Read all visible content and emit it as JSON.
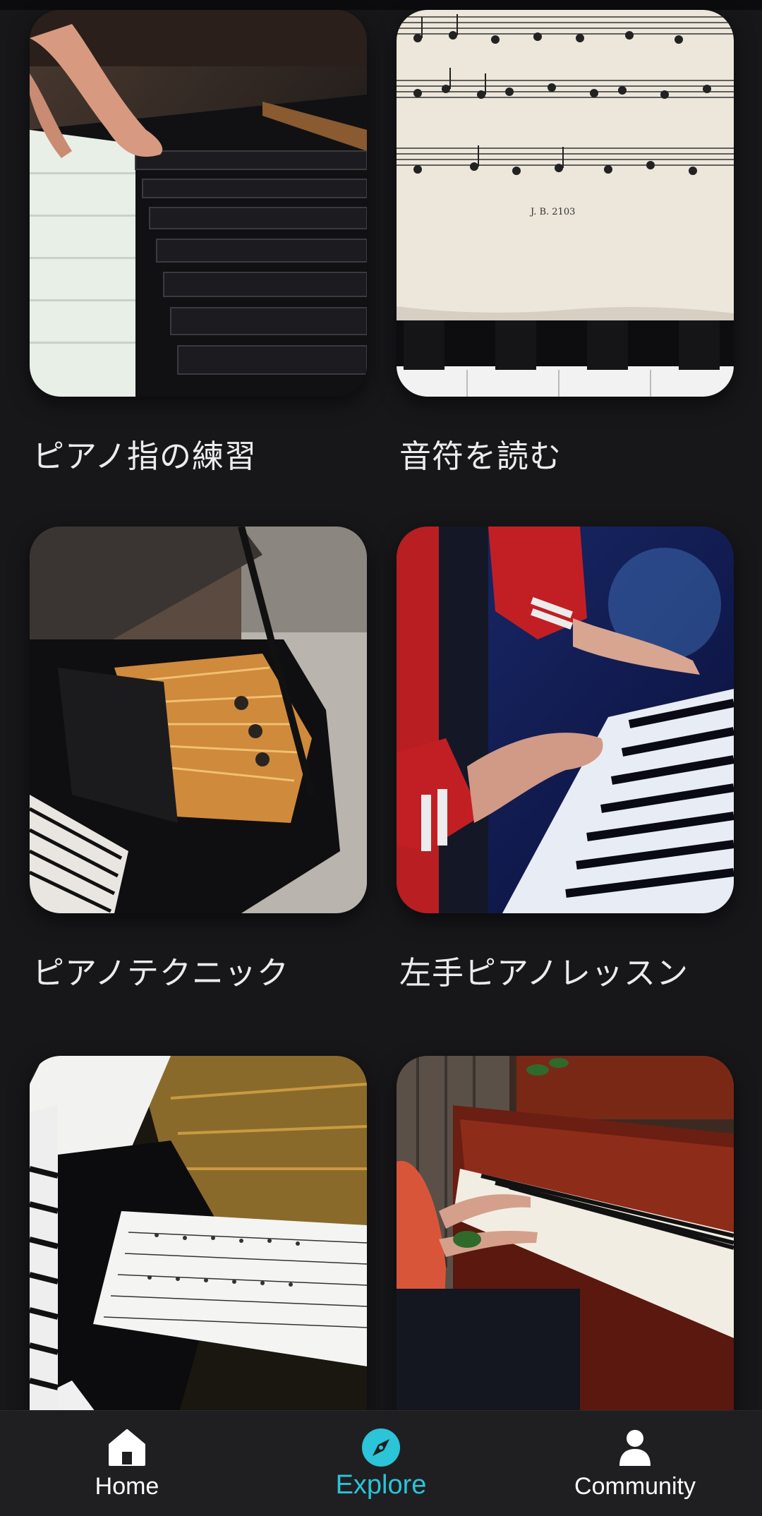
{
  "cards": [
    {
      "title": "ピアノ指の練習"
    },
    {
      "title": "音符を読む"
    },
    {
      "title": "ピアノテクニック"
    },
    {
      "title": "左手ピアノレッスン"
    },
    {
      "title": ""
    },
    {
      "title": ""
    }
  ],
  "sheet_music_caption": "J. B. 2103",
  "nav": {
    "items": [
      {
        "label": "Home",
        "icon": "home-icon",
        "active": false
      },
      {
        "label": "Explore",
        "icon": "compass-icon",
        "active": true
      },
      {
        "label": "Community",
        "icon": "person-icon",
        "active": false
      }
    ],
    "active_color": "#2bc4d8",
    "inactive_color": "#ffffff"
  }
}
